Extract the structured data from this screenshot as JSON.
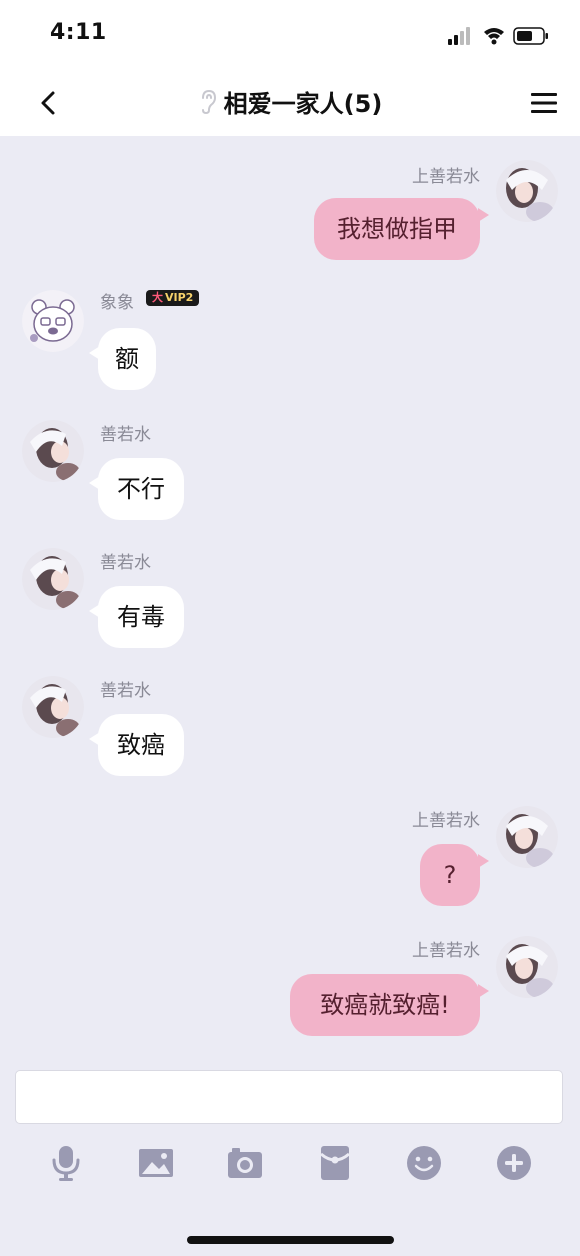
{
  "status_bar": {
    "time": "4:11",
    "icons": [
      "cellular-signal-icon",
      "wifi-icon",
      "battery-icon"
    ]
  },
  "nav": {
    "title": "相爱一家人(5)",
    "icons": [
      "back-chevron-icon",
      "ear-icon",
      "menu-icon"
    ]
  },
  "messages": [
    {
      "side": "right",
      "sender": "上善若水",
      "text": "我想做指甲",
      "avatar": "photo-avatar"
    },
    {
      "side": "left",
      "sender": "象象",
      "badge": "VIP2",
      "badge_prefix": "大",
      "text": "额",
      "avatar": "bear-avatar"
    },
    {
      "side": "left",
      "sender": "善若水",
      "text": "不行",
      "avatar": "photo-avatar"
    },
    {
      "side": "left",
      "sender": "善若水",
      "text": "有毒",
      "avatar": "photo-avatar"
    },
    {
      "side": "left",
      "sender": "善若水",
      "text": "致癌",
      "avatar": "photo-avatar"
    },
    {
      "side": "right",
      "sender": "上善若水",
      "text": "?",
      "avatar": "photo-avatar"
    },
    {
      "side": "right",
      "sender": "上善若水",
      "text": "致癌就致癌!",
      "avatar": "photo-avatar"
    }
  ],
  "input": {
    "value": "",
    "placeholder": ""
  },
  "toolbar": [
    {
      "icon": "microphone-icon"
    },
    {
      "icon": "image-icon"
    },
    {
      "icon": "camera-icon"
    },
    {
      "icon": "red-packet-icon"
    },
    {
      "icon": "emoji-icon"
    },
    {
      "icon": "plus-icon"
    }
  ],
  "colors": {
    "background": "#ebebf4",
    "outgoing_bubble": "#f2b3c9",
    "incoming_bubble": "#ffffff",
    "sender_text": "#8a8a96",
    "toolbar_icon": "#9a9ab2"
  }
}
